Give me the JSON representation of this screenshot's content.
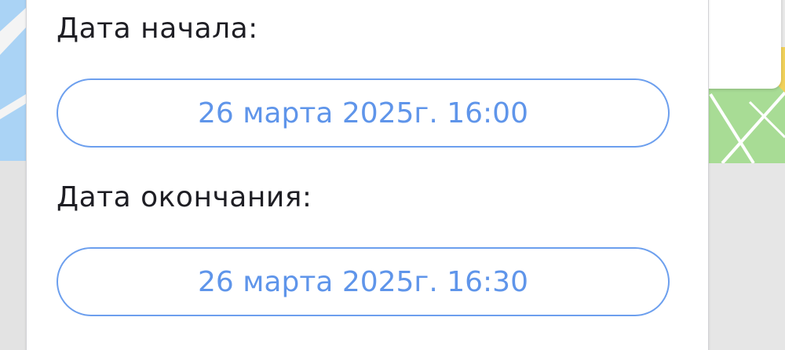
{
  "form": {
    "start": {
      "label": "Дата начала:",
      "value": "26 марта 2025г. 16:00"
    },
    "end": {
      "label": "Дата окончания:",
      "value": "26 марта 2025г. 16:30"
    }
  },
  "colors": {
    "accent": "#5f95ea",
    "label_text": "#1e1e24",
    "panel_bg": "#ffffff",
    "map_gray": "#e9e9e9",
    "map_green": "#a8dc95",
    "map_blue": "#aad3f5"
  }
}
